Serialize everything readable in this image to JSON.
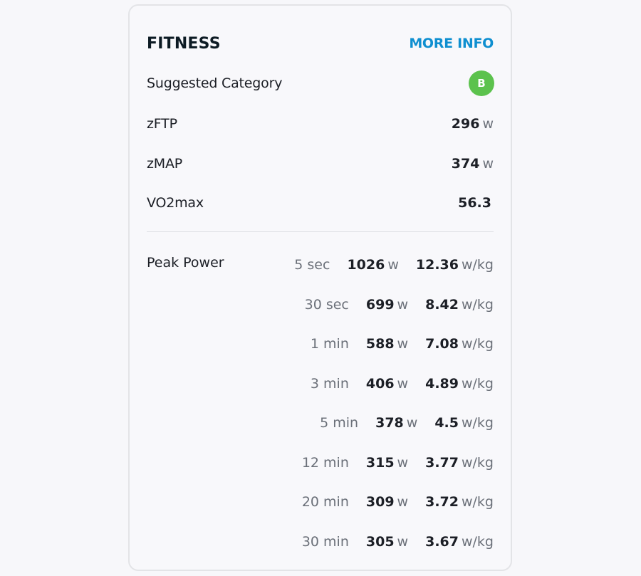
{
  "card": {
    "title": "FITNESS",
    "more_info_label": "MORE INFO",
    "colors": {
      "accent": "#0f8fd0",
      "badge": "#5cc24d",
      "text": "#1c1f26",
      "muted": "#6b7079"
    }
  },
  "metrics": [
    {
      "label": "Suggested Category",
      "badge": "B"
    },
    {
      "label": "zFTP",
      "value": "296",
      "unit": "w"
    },
    {
      "label": "zMAP",
      "value": "374",
      "unit": "w"
    },
    {
      "label": "VO2max",
      "value": "56.3"
    }
  ],
  "peak_power": {
    "label": "Peak Power",
    "watt_unit": "w",
    "wkg_unit": "w/kg",
    "rows": [
      {
        "duration": "5 sec",
        "watts": "1026",
        "wkg": "12.36"
      },
      {
        "duration": "30 sec",
        "watts": "699",
        "wkg": "8.42"
      },
      {
        "duration": "1 min",
        "watts": "588",
        "wkg": "7.08"
      },
      {
        "duration": "3 min",
        "watts": "406",
        "wkg": "4.89"
      },
      {
        "duration": "5 min",
        "watts": "378",
        "wkg": "4.5"
      },
      {
        "duration": "12 min",
        "watts": "315",
        "wkg": "3.77"
      },
      {
        "duration": "20 min",
        "watts": "309",
        "wkg": "3.72"
      },
      {
        "duration": "30 min",
        "watts": "305",
        "wkg": "3.67"
      }
    ]
  }
}
